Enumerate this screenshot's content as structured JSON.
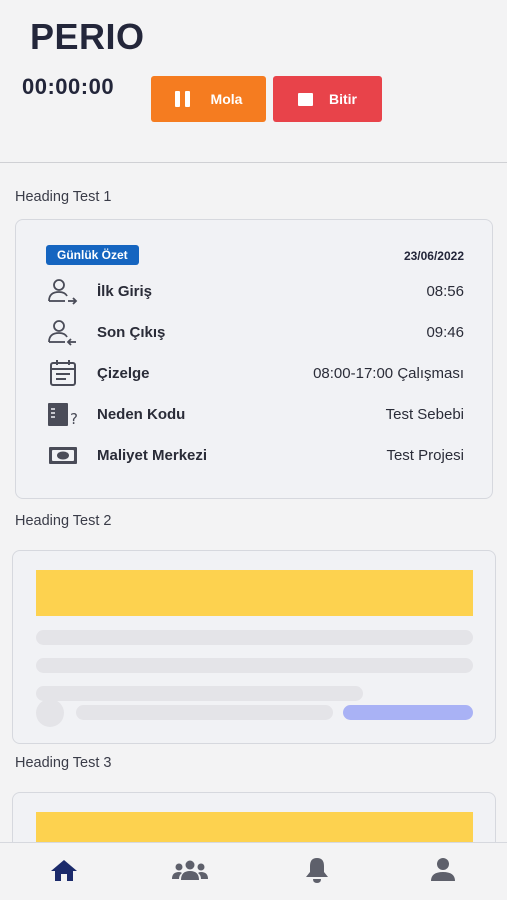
{
  "app": {
    "title": "PERIO"
  },
  "timer": {
    "value": "00:00:00"
  },
  "actions": {
    "pause_label": "Mola",
    "stop_label": "Bitir"
  },
  "colors": {
    "pause": "#f57c20",
    "stop": "#e8434a",
    "badge": "#1565c0",
    "skeleton_primary": "#fdd24f",
    "skeleton_accent": "#a9b2f5",
    "nav_active": "#1b2a6b",
    "nav_inactive": "#5e606b"
  },
  "sections": [
    {
      "heading": "Heading Test 1"
    },
    {
      "heading": "Heading Test 2"
    },
    {
      "heading": "Heading Test 3"
    }
  ],
  "summary_card": {
    "badge": "Günlük Özet",
    "date": "23/06/2022",
    "rows": [
      {
        "icon": "user-login-icon",
        "label": "İlk Giriş",
        "value": "08:56"
      },
      {
        "icon": "user-logout-icon",
        "label": "Son Çıkış",
        "value": "09:46"
      },
      {
        "icon": "calendar-icon",
        "label": "Çizelge",
        "value": "08:00-17:00 Çalışması"
      },
      {
        "icon": "reason-code-icon",
        "label": "Neden Kodu",
        "value": "Test Sebebi"
      },
      {
        "icon": "money-icon",
        "label": "Maliyet Merkezi",
        "value": "Test Projesi"
      }
    ]
  },
  "bottom_nav": [
    {
      "icon": "home-icon",
      "active": true
    },
    {
      "icon": "team-icon",
      "active": false
    },
    {
      "icon": "bell-icon",
      "active": false
    },
    {
      "icon": "profile-icon",
      "active": false
    }
  ]
}
